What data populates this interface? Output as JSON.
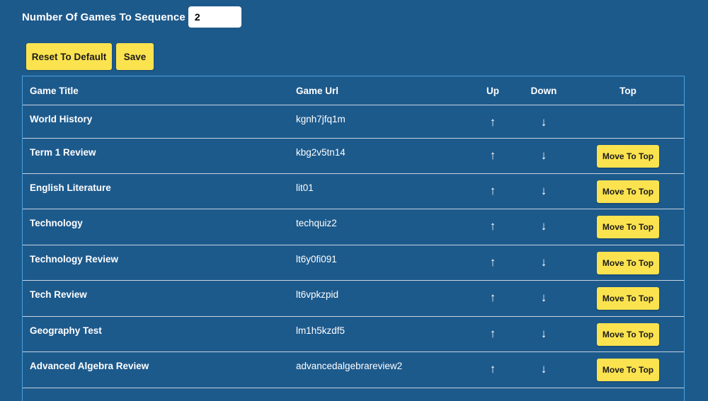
{
  "sequence": {
    "label": "Number Of Games To Sequence",
    "value": "2"
  },
  "buttons": {
    "reset_label": "Reset To Default",
    "save_label": "Save",
    "move_to_top_label": "Move To Top"
  },
  "table": {
    "headers": {
      "title": "Game Title",
      "url": "Game Url",
      "up": "Up",
      "down": "Down",
      "top": "Top"
    },
    "rows": [
      {
        "title": "World History",
        "url": "kgnh7jfq1m",
        "has_move_to_top": false
      },
      {
        "title": "Term 1 Review",
        "url": "kbg2v5tn14",
        "has_move_to_top": true
      },
      {
        "title": "English Literature",
        "url": "lit01",
        "has_move_to_top": true
      },
      {
        "title": "Technology",
        "url": "techquiz2",
        "has_move_to_top": true
      },
      {
        "title": "Technology Review",
        "url": "lt6y0fi091",
        "has_move_to_top": true
      },
      {
        "title": "Tech Review",
        "url": "lt6vpkzpid",
        "has_move_to_top": true
      },
      {
        "title": "Geography Test",
        "url": "lm1h5kzdf5",
        "has_move_to_top": true
      },
      {
        "title": "Advanced Algebra Review",
        "url": "advancedalgebrareview2",
        "has_move_to_top": true
      }
    ]
  },
  "icons": {
    "up": "↑",
    "down": "↓"
  },
  "colors": {
    "background": "#1d5a8c",
    "button": "#fbe34f",
    "table_border": "#4aa0de"
  }
}
